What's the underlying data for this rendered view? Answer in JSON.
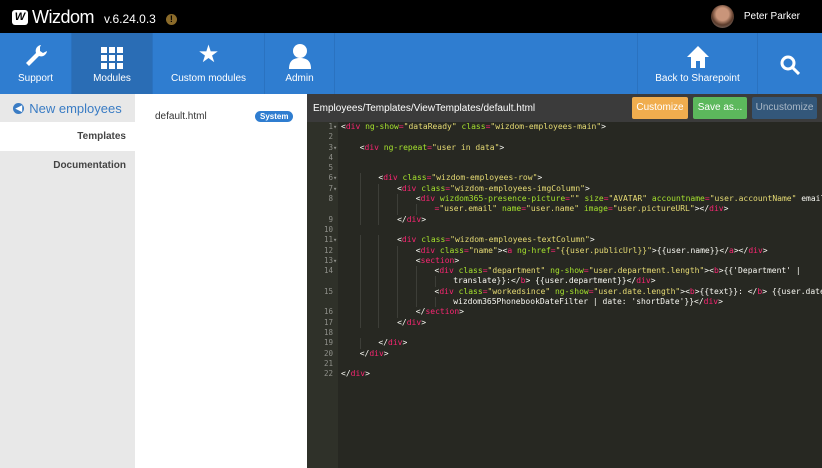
{
  "header": {
    "logo_mark": "W",
    "app_name": "Wizdom",
    "version": "v.6.24.0.3",
    "info_icon": "!",
    "user_name": "Peter Parker"
  },
  "nav": {
    "items": [
      {
        "label": "Support",
        "icon": "wrench-icon"
      },
      {
        "label": "Modules",
        "icon": "grid-icon",
        "active": true
      },
      {
        "label": "Custom modules",
        "icon": "star-icon"
      },
      {
        "label": "Admin",
        "icon": "user-icon"
      }
    ],
    "back_label": "Back to Sharepoint",
    "search_icon": "search-icon"
  },
  "sidebar": {
    "back_label": "New employees",
    "tabs": [
      {
        "label": "Templates",
        "active": true
      },
      {
        "label": "Documentation"
      }
    ]
  },
  "files": [
    {
      "name": "default.html",
      "badge": "System"
    }
  ],
  "editor": {
    "path": "Employees/Templates/ViewTemplates/default.html",
    "buttons": {
      "customize": "Customize",
      "save_as": "Save as...",
      "uncustomize": "Uncustomize"
    },
    "colors": {
      "customize": "#f0ad4e",
      "save_as": "#5cb85c",
      "uncustomize": "#33577a"
    },
    "lines": [
      {
        "n": 1,
        "fold": true,
        "indent": 0,
        "text": "<div ng-show=\"dataReady\" class=\"wizdom-employees-main\">"
      },
      {
        "n": 2,
        "indent": 0,
        "text": ""
      },
      {
        "n": 3,
        "fold": true,
        "indent": 1,
        "text": "<div ng-repeat=\"user in data\">"
      },
      {
        "n": 4,
        "indent": 0,
        "text": ""
      },
      {
        "n": 5,
        "indent": 0,
        "text": ""
      },
      {
        "n": 6,
        "fold": true,
        "indent": 2,
        "text": "<div class=\"wizdom-employees-row\">"
      },
      {
        "n": 7,
        "fold": true,
        "indent": 3,
        "text": "<div class=\"wizdom-employees-imgColumn\">"
      },
      {
        "n": 8,
        "indent": 4,
        "text": "<div wizdom365-presence-picture=\"\" size=\"AVATAR\" accountname=\"user.accountName\" email",
        "cont": "=\"user.email\" name=\"user.name\" image=\"user.pictureURL\"></div>"
      },
      {
        "n": 9,
        "indent": 3,
        "text": "</div>"
      },
      {
        "n": 10,
        "indent": 0,
        "text": ""
      },
      {
        "n": 11,
        "fold": true,
        "indent": 3,
        "text": "<div class=\"wizdom-employees-textColumn\">"
      },
      {
        "n": 12,
        "indent": 4,
        "text": "<div class=\"name\"><a ng-href=\"{{user.publicUrl}}\">{{user.name}}</a></div>"
      },
      {
        "n": 13,
        "fold": true,
        "indent": 4,
        "text": "<section>"
      },
      {
        "n": 14,
        "indent": 5,
        "text": "<div class=\"department\" ng-show=\"user.department.length\"><b>{{'Department' |",
        "cont": "translate}}:</b> {{user.department}}</div>"
      },
      {
        "n": 15,
        "indent": 5,
        "text": "<div class=\"workedsince\" ng-show=\"user.date.length\"><b>{{text}}: </b> {{user.date |",
        "cont": "wizdom365PhonebookDateFilter | date: 'shortDate'}}</div>"
      },
      {
        "n": 16,
        "indent": 4,
        "text": "</section>"
      },
      {
        "n": 17,
        "indent": 3,
        "text": "</div>"
      },
      {
        "n": 18,
        "indent": 0,
        "text": ""
      },
      {
        "n": 19,
        "indent": 2,
        "text": "</div>"
      },
      {
        "n": 20,
        "indent": 1,
        "text": "</div>"
      },
      {
        "n": 21,
        "indent": 0,
        "text": ""
      },
      {
        "n": 22,
        "indent": 0,
        "text": "</div>"
      }
    ]
  }
}
